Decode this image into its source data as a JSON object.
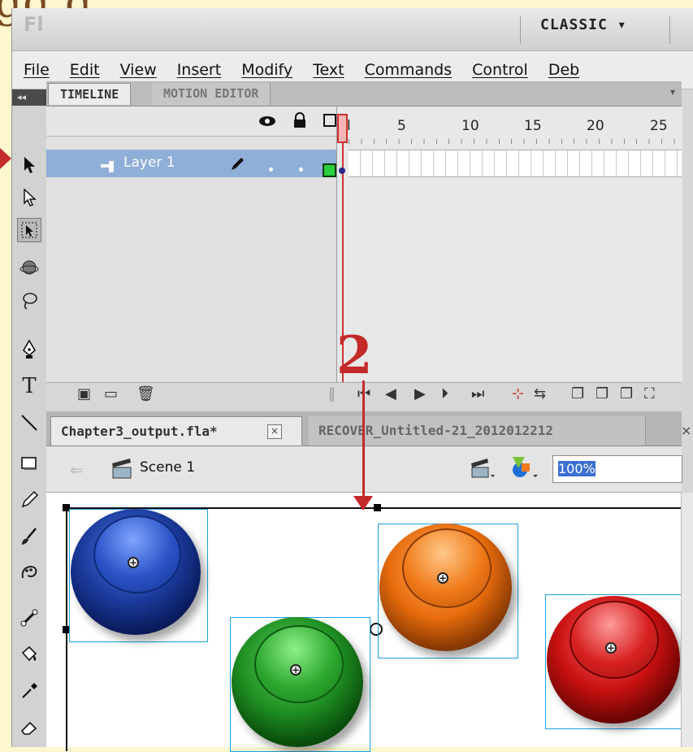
{
  "slide_title": "gg g",
  "app": {
    "logo": "Fl",
    "workspace": "CLASSIC ▾"
  },
  "menu": [
    "File",
    "Edit",
    "View",
    "Insert",
    "Modify",
    "Text",
    "Commands",
    "Control",
    "Deb"
  ],
  "tools_header": "◂◂",
  "timeline": {
    "tabs": [
      "TIMELINE",
      "MOTION EDITOR"
    ],
    "layer_name": "Layer 1",
    "ruler": [
      "l",
      "5",
      "10",
      "15",
      "20",
      "25"
    ]
  },
  "documents": {
    "tabs": [
      "Chapter3_output.fla*",
      "RECOVER_Untitled-21_2012012212"
    ],
    "close_symbol": "×"
  },
  "editbar": {
    "scene": "Scene 1",
    "zoom": "100%"
  },
  "annotation": {
    "step": "2"
  },
  "colors": {
    "blue_button": "#1b3a9b",
    "green_button": "#1f8f22",
    "orange_button": "#e86c0c",
    "red_button": "#c81010",
    "annotation": "#c42a2a",
    "layer_highlight": "#8faed8"
  }
}
